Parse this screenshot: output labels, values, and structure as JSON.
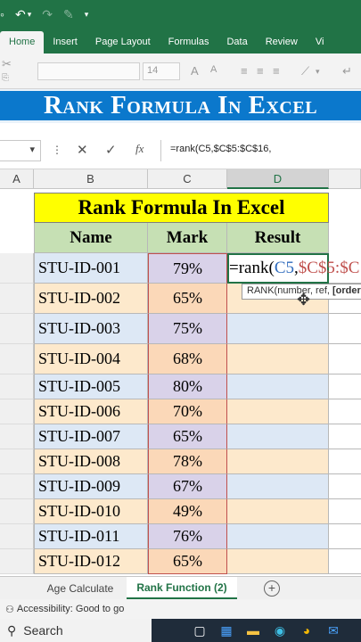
{
  "ribbon": {
    "tabs": [
      "Home",
      "Insert",
      "Page Layout",
      "Formulas",
      "Data",
      "Review",
      "Vi"
    ],
    "font_size": "14"
  },
  "banner": {
    "text": "Rank Formula In Excel"
  },
  "formula_bar": {
    "fx": "fx",
    "content": "=rank(C5,$C$5:$C$16,"
  },
  "columns": [
    "A",
    "B",
    "C",
    "D"
  ],
  "sheet": {
    "title": "Rank Formula In Excel",
    "headers": {
      "name": "Name",
      "mark": "Mark",
      "result": "Result"
    },
    "rows": [
      {
        "name": "STU-ID-001",
        "mark": "79%"
      },
      {
        "name": "STU-ID-002",
        "mark": "65%"
      },
      {
        "name": "STU-ID-003",
        "mark": "75%"
      },
      {
        "name": "STU-ID-004",
        "mark": "68%"
      },
      {
        "name": "STU-ID-005",
        "mark": "80%"
      },
      {
        "name": "STU-ID-006",
        "mark": "70%"
      },
      {
        "name": "STU-ID-007",
        "mark": "65%"
      },
      {
        "name": "STU-ID-008",
        "mark": "78%"
      },
      {
        "name": "STU-ID-009",
        "mark": "67%"
      },
      {
        "name": "STU-ID-010",
        "mark": "49%"
      },
      {
        "name": "STU-ID-011",
        "mark": "76%"
      },
      {
        "name": "STU-ID-012",
        "mark": "65%"
      }
    ],
    "editing": {
      "prefix": "=rank(",
      "ref1": "C5",
      "sep": ",",
      "ref2": "$C$5:$C"
    },
    "tooltip": {
      "fn": "RANK(",
      "args": "number, ref, ",
      "current": "[order"
    }
  },
  "sheet_tabs": [
    "Age Calculate",
    "Rank Function (2)"
  ],
  "status": {
    "accessibility": "Accessibility: Good to go"
  },
  "taskbar": {
    "search": "Search"
  },
  "colors": {
    "excel_green": "#217346",
    "banner_blue": "#0b78cc",
    "title_yellow": "#ffff00",
    "header_green": "#c6e0b4",
    "row_blue": "#dde8f5",
    "row_peach": "#fde9cc",
    "mark_purple": "#d9d2e9",
    "mark_orange": "#fbd8b8"
  }
}
